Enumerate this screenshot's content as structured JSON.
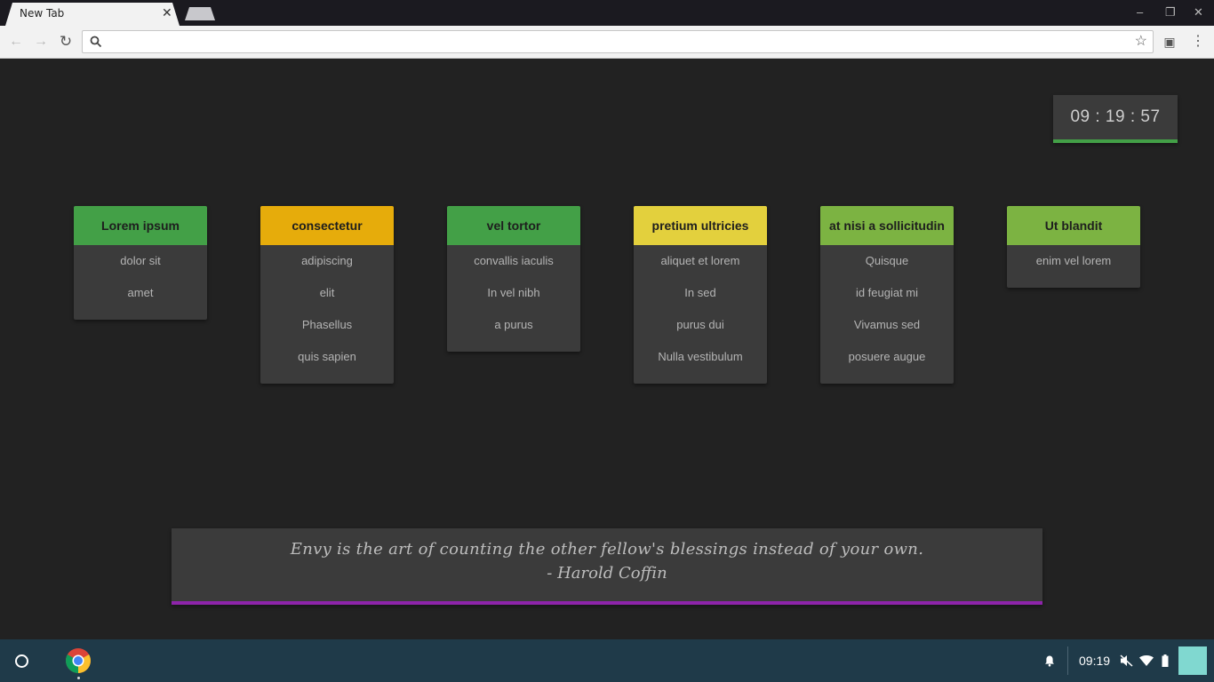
{
  "browser": {
    "tab_title": "New Tab",
    "tab_close": "✕",
    "window_controls": {
      "minimize": "–",
      "restore": "❐",
      "close": "✕"
    },
    "omnibox": {
      "value": "",
      "placeholder": ""
    },
    "icons": {
      "back": "←",
      "forward": "→",
      "reload": "↻",
      "star": "☆",
      "cast": "▣",
      "menu": "⋮"
    }
  },
  "clock": {
    "time": "09 : 19 : 57",
    "accent": "#43a047"
  },
  "cards": [
    {
      "title": "Lorem ipsum",
      "color": "#43a047",
      "links": [
        "dolor sit",
        "amet"
      ]
    },
    {
      "title": "consectetur",
      "color": "#e6ac0b",
      "links": [
        "adipiscing",
        "elit",
        "Phasellus",
        "quis sapien"
      ]
    },
    {
      "title": "vel tortor",
      "color": "#43a047",
      "links": [
        "convallis iaculis",
        "In vel nibh",
        "a purus"
      ]
    },
    {
      "title": "pretium ultricies",
      "color": "#e3d03d",
      "links": [
        "aliquet et lorem",
        "In sed",
        "purus dui",
        "Nulla vestibulum"
      ]
    },
    {
      "title": "at nisi a sollicitudin",
      "color": "#7cb342",
      "links": [
        "Quisque",
        "id feugiat mi",
        "Vivamus sed",
        "posuere augue"
      ]
    },
    {
      "title": "Ut blandit",
      "color": "#7cb342",
      "links": [
        "enim vel lorem"
      ]
    }
  ],
  "quote": {
    "text": "Envy is the art of counting the other fellow's blessings instead of your own.",
    "author": "- Harold Coffin",
    "accent": "#8e24aa"
  },
  "shelf": {
    "time": "09:19",
    "icons": {
      "notifications": "bell-icon",
      "volume": "muted-speaker-icon",
      "wifi": "wifi-icon",
      "battery": "battery-icon"
    }
  }
}
